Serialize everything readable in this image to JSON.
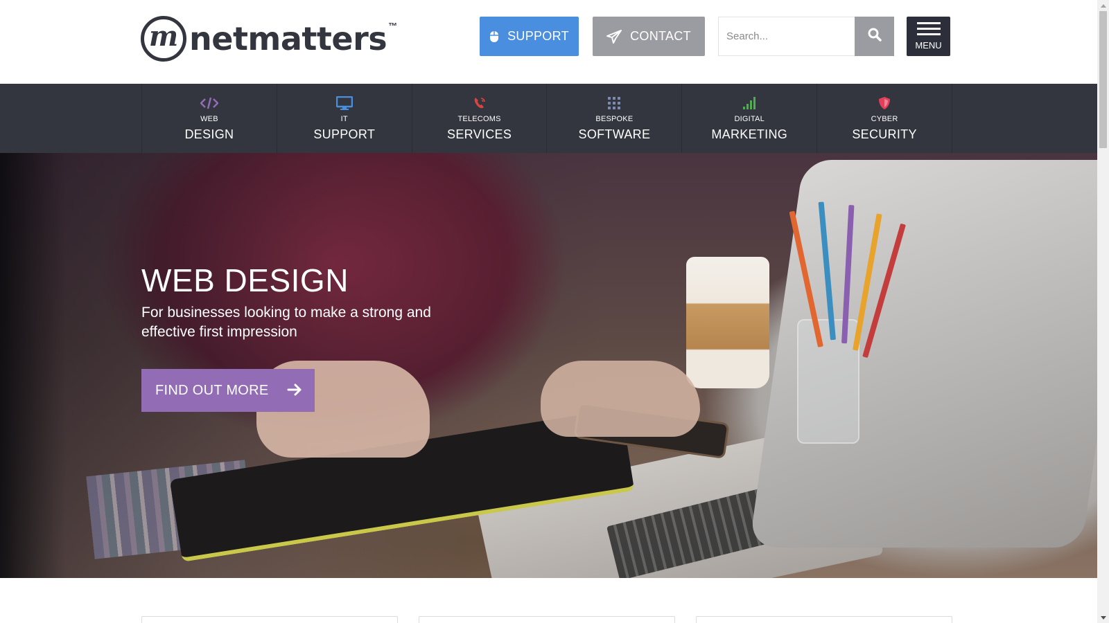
{
  "brand": {
    "name": "netmatters",
    "mark": "m",
    "tm": "™"
  },
  "header": {
    "support_label": "SUPPORT",
    "contact_label": "CONTACT",
    "search_placeholder": "Search...",
    "menu_label": "MENU"
  },
  "nav": {
    "items": [
      {
        "small": "WEB",
        "big": "DESIGN",
        "icon": "code-icon",
        "color": "#926db5"
      },
      {
        "small": "IT",
        "big": "SUPPORT",
        "icon": "monitor-icon",
        "color": "#4a8ee0"
      },
      {
        "small": "TELECOMS",
        "big": "SERVICES",
        "icon": "phone-icon",
        "color": "#d64541"
      },
      {
        "small": "BESPOKE",
        "big": "SOFTWARE",
        "icon": "grid-icon",
        "color": "#7b8bad"
      },
      {
        "small": "DIGITAL",
        "big": "MARKETING",
        "icon": "signal-bars-icon",
        "color": "#4cae4c"
      },
      {
        "small": "CYBER",
        "big": "SECURITY",
        "icon": "shield-icon",
        "color": "#e53e5a"
      }
    ]
  },
  "hero": {
    "title": "WEB DESIGN",
    "subtitle": "For businesses looking to make a strong and effective first impression",
    "cta_label": "FIND OUT MORE",
    "cta_color": "#926db5"
  },
  "colors": {
    "support_button": "#4a8ee0",
    "contact_button": "#9b9ca1",
    "nav_background": "#33353f",
    "menu_button": "#2c2f3a"
  }
}
